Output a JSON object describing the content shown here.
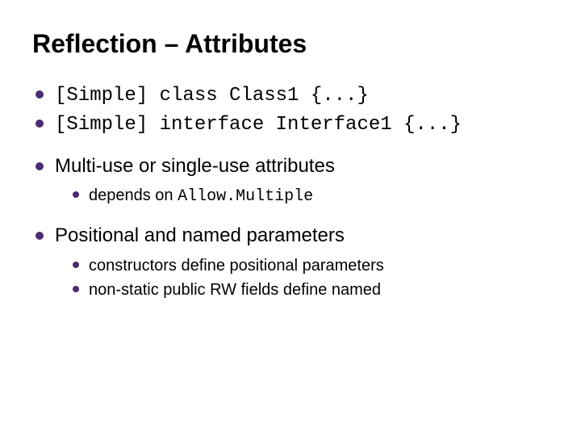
{
  "title": "Reflection – Attributes",
  "bullets": {
    "b1": "[Simple] class Class1 {...}",
    "b2": "[Simple] interface Interface1 {...}",
    "b3": "Multi-use or single-use attributes",
    "b3_1_prefix": "depends on ",
    "b3_1_code_a": "Allow.",
    "b3_1_code_b": "Multiple",
    "b4": "Positional and named parameters",
    "b4_1": "constructors define positional parameters",
    "b4_2": "non-static public RW fields define named"
  }
}
